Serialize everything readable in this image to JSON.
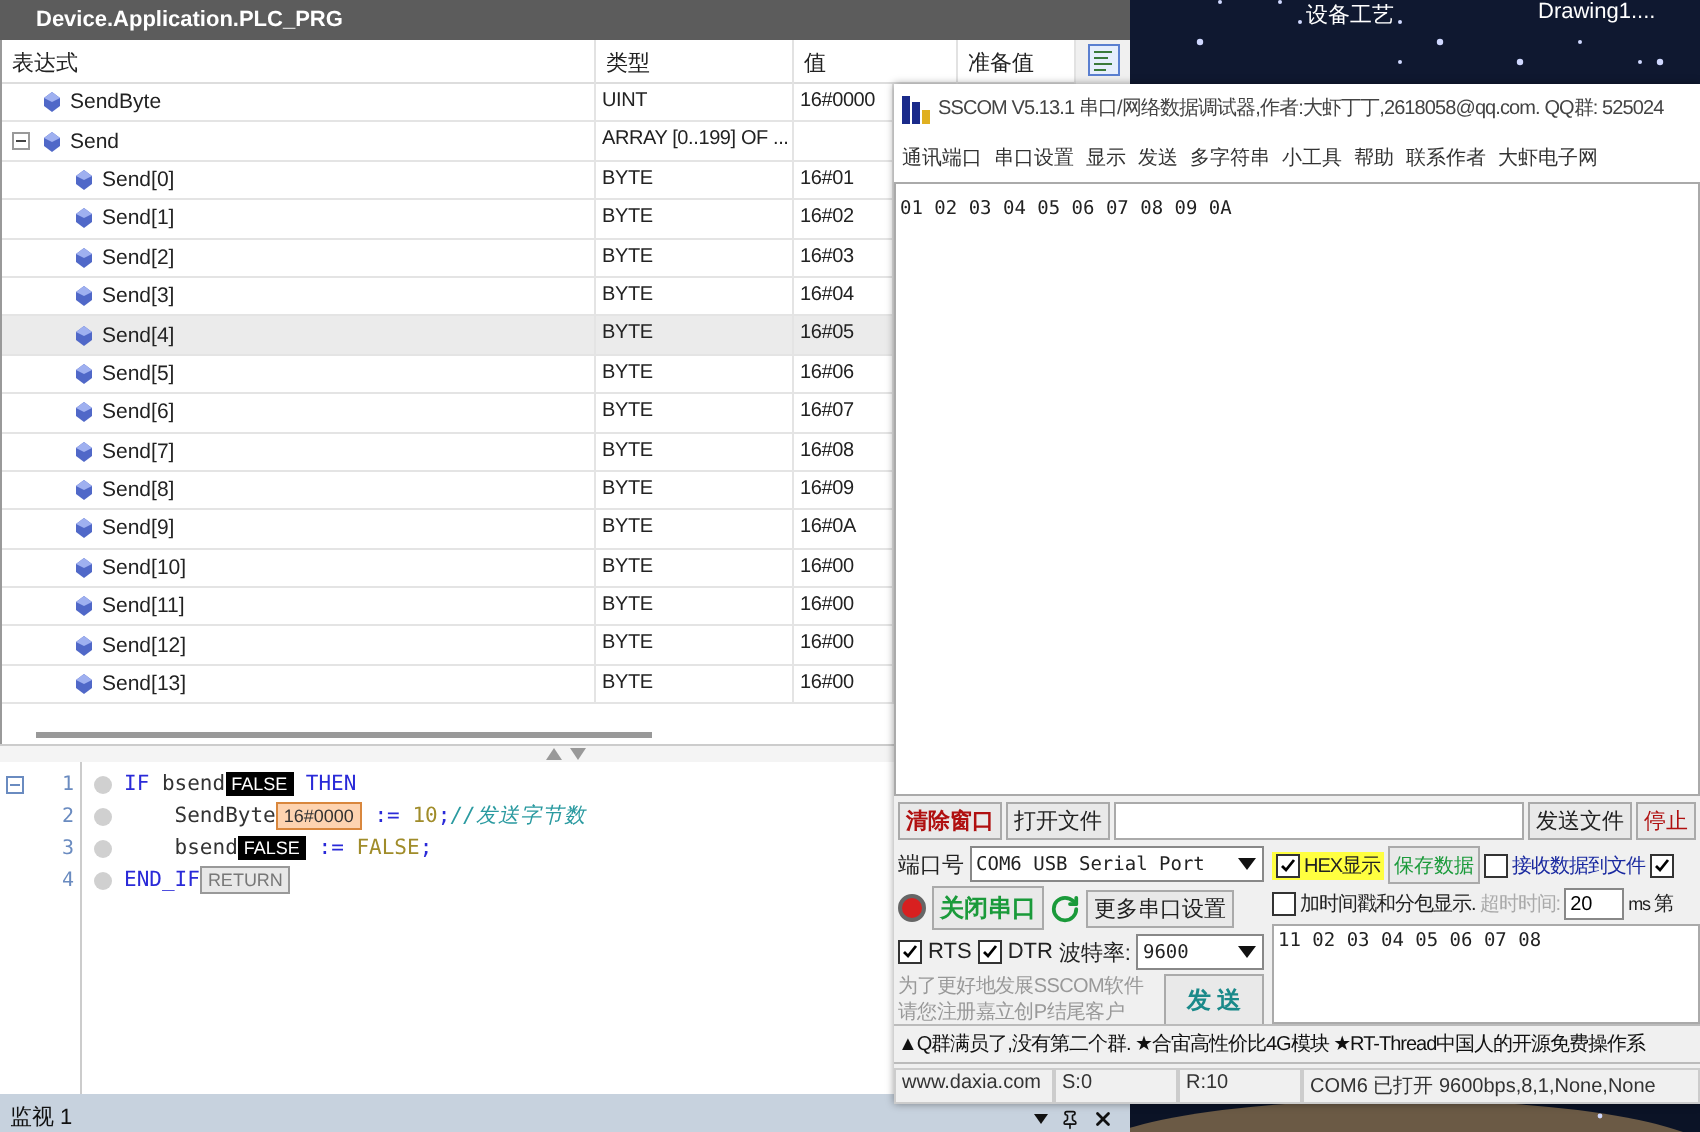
{
  "desktop": {
    "icons": [
      {
        "label": "设备工艺"
      },
      {
        "label": "Drawing1...."
      }
    ]
  },
  "ide": {
    "title": "Device.Application.PLC_PRG",
    "columns": [
      "表达式",
      "类型",
      "值",
      "准备值"
    ],
    "rows": [
      {
        "name": "SendByte",
        "type": "UINT",
        "value": "16#0000",
        "selected": false
      },
      {
        "name": "Send",
        "type": "ARRAY [0..199] OF ...",
        "selected": false,
        "expanded": true,
        "children": [
          {
            "name": "Send[0]",
            "type": "BYTE",
            "value": "16#01",
            "selected": false
          },
          {
            "name": "Send[1]",
            "type": "BYTE",
            "value": "16#02",
            "selected": false
          },
          {
            "name": "Send[2]",
            "type": "BYTE",
            "value": "16#03",
            "selected": false
          },
          {
            "name": "Send[3]",
            "type": "BYTE",
            "value": "16#04",
            "selected": false
          },
          {
            "name": "Send[4]",
            "type": "BYTE",
            "value": "16#05",
            "selected": true
          },
          {
            "name": "Send[5]",
            "type": "BYTE",
            "value": "16#06",
            "selected": false
          },
          {
            "name": "Send[6]",
            "type": "BYTE",
            "value": "16#07",
            "selected": false
          },
          {
            "name": "Send[7]",
            "type": "BYTE",
            "value": "16#08",
            "selected": false
          },
          {
            "name": "Send[8]",
            "type": "BYTE",
            "value": "16#09",
            "selected": false
          },
          {
            "name": "Send[9]",
            "type": "BYTE",
            "value": "16#0A",
            "selected": false
          },
          {
            "name": "Send[10]",
            "type": "BYTE",
            "value": "16#00",
            "selected": false
          },
          {
            "name": "Send[11]",
            "type": "BYTE",
            "value": "16#00",
            "selected": false
          },
          {
            "name": "Send[12]",
            "type": "BYTE",
            "value": "16#00",
            "selected": false
          },
          {
            "name": "Send[13]",
            "type": "BYTE",
            "value": "16#00",
            "selected": false
          }
        ]
      }
    ],
    "code": [
      {
        "number": "1",
        "collapsible": true,
        "tokens": [
          {
            "kind": "keyword",
            "text": "IF "
          },
          {
            "kind": "ident",
            "text": "bsend"
          },
          {
            "kind": "bool",
            "text": "FALSE"
          },
          {
            "kind": "keyword",
            "text": " THEN"
          }
        ]
      },
      {
        "number": "2",
        "collapsible": false,
        "tokens": [
          {
            "kind": "ident",
            "text": "    SendByte"
          },
          {
            "kind": "value",
            "text": "16#0000"
          },
          {
            "kind": "op",
            "text": " := "
          },
          {
            "kind": "constant",
            "text": "10"
          },
          {
            "kind": "op",
            "text": ";"
          },
          {
            "kind": "comment",
            "text": "//发送字节数"
          }
        ]
      },
      {
        "number": "3",
        "collapsible": false,
        "tokens": [
          {
            "kind": "ident",
            "text": "    bsend"
          },
          {
            "kind": "bool",
            "text": "FALSE"
          },
          {
            "kind": "op",
            "text": " := "
          },
          {
            "kind": "constant",
            "text": "FALSE"
          },
          {
            "kind": "op",
            "text": ";"
          }
        ]
      },
      {
        "number": "4",
        "collapsible": false,
        "tokens": [
          {
            "kind": "keyword",
            "text": "END_IF"
          },
          {
            "kind": "return",
            "text": "RETURN"
          }
        ]
      }
    ],
    "bottom_tab": "监视 1"
  },
  "sscom": {
    "title": "SSCOM V5.13.1 串口/网络数据调试器,作者:大虾丁丁,2618058@qq.com. QQ群: 525024",
    "menu": [
      "通讯端口",
      "串口设置",
      "显示",
      "发送",
      "多字符串",
      "小工具",
      "帮助",
      "联系作者",
      "大虾电子网"
    ],
    "receive": "01 02 03 04 05 06 07 08 09 0A",
    "clear": "清除窗口",
    "open_file": "打开文件",
    "send_file": "发送文件",
    "stop": "停止",
    "port": {
      "label": "端口号",
      "value": "COM6 USB Serial Port"
    },
    "connected": true,
    "open_button": "关闭串口",
    "more_settings": "更多串口设置",
    "rts": {
      "label": "RTS",
      "checked": true
    },
    "dtr": {
      "label": "DTR",
      "checked": true
    },
    "baud": {
      "label": "波特率:",
      "value": "9600"
    },
    "promo": [
      "为了更好地发展SSCOM软件",
      "请您注册嘉立创P结尾客户"
    ],
    "send_button": "发 送",
    "hex_display": {
      "label": "HEX显示",
      "checked": true
    },
    "save_data": "保存数据",
    "receive_to_file": {
      "label": "接收数据到文件",
      "checked": false
    },
    "edge_check": {
      "checked": true
    },
    "timestamp": {
      "label": "加时间戳和分包显示.",
      "checked": false
    },
    "timeout": {
      "label": "超时时间:",
      "value": "20",
      "unit": "ms",
      "disabled": true
    },
    "edge_label": "第",
    "send_text": "11 02 03 04 05 06 07 08",
    "ticker": "▲Q群满员了,没有第二个群. ★合宙高性价比4G模块 ★RT-Thread中国人的开源免费操作系",
    "status": [
      "www.daxia.com",
      "S:0",
      "R:10",
      "COM6 已打开  9600bps,8,1,None,None"
    ]
  }
}
